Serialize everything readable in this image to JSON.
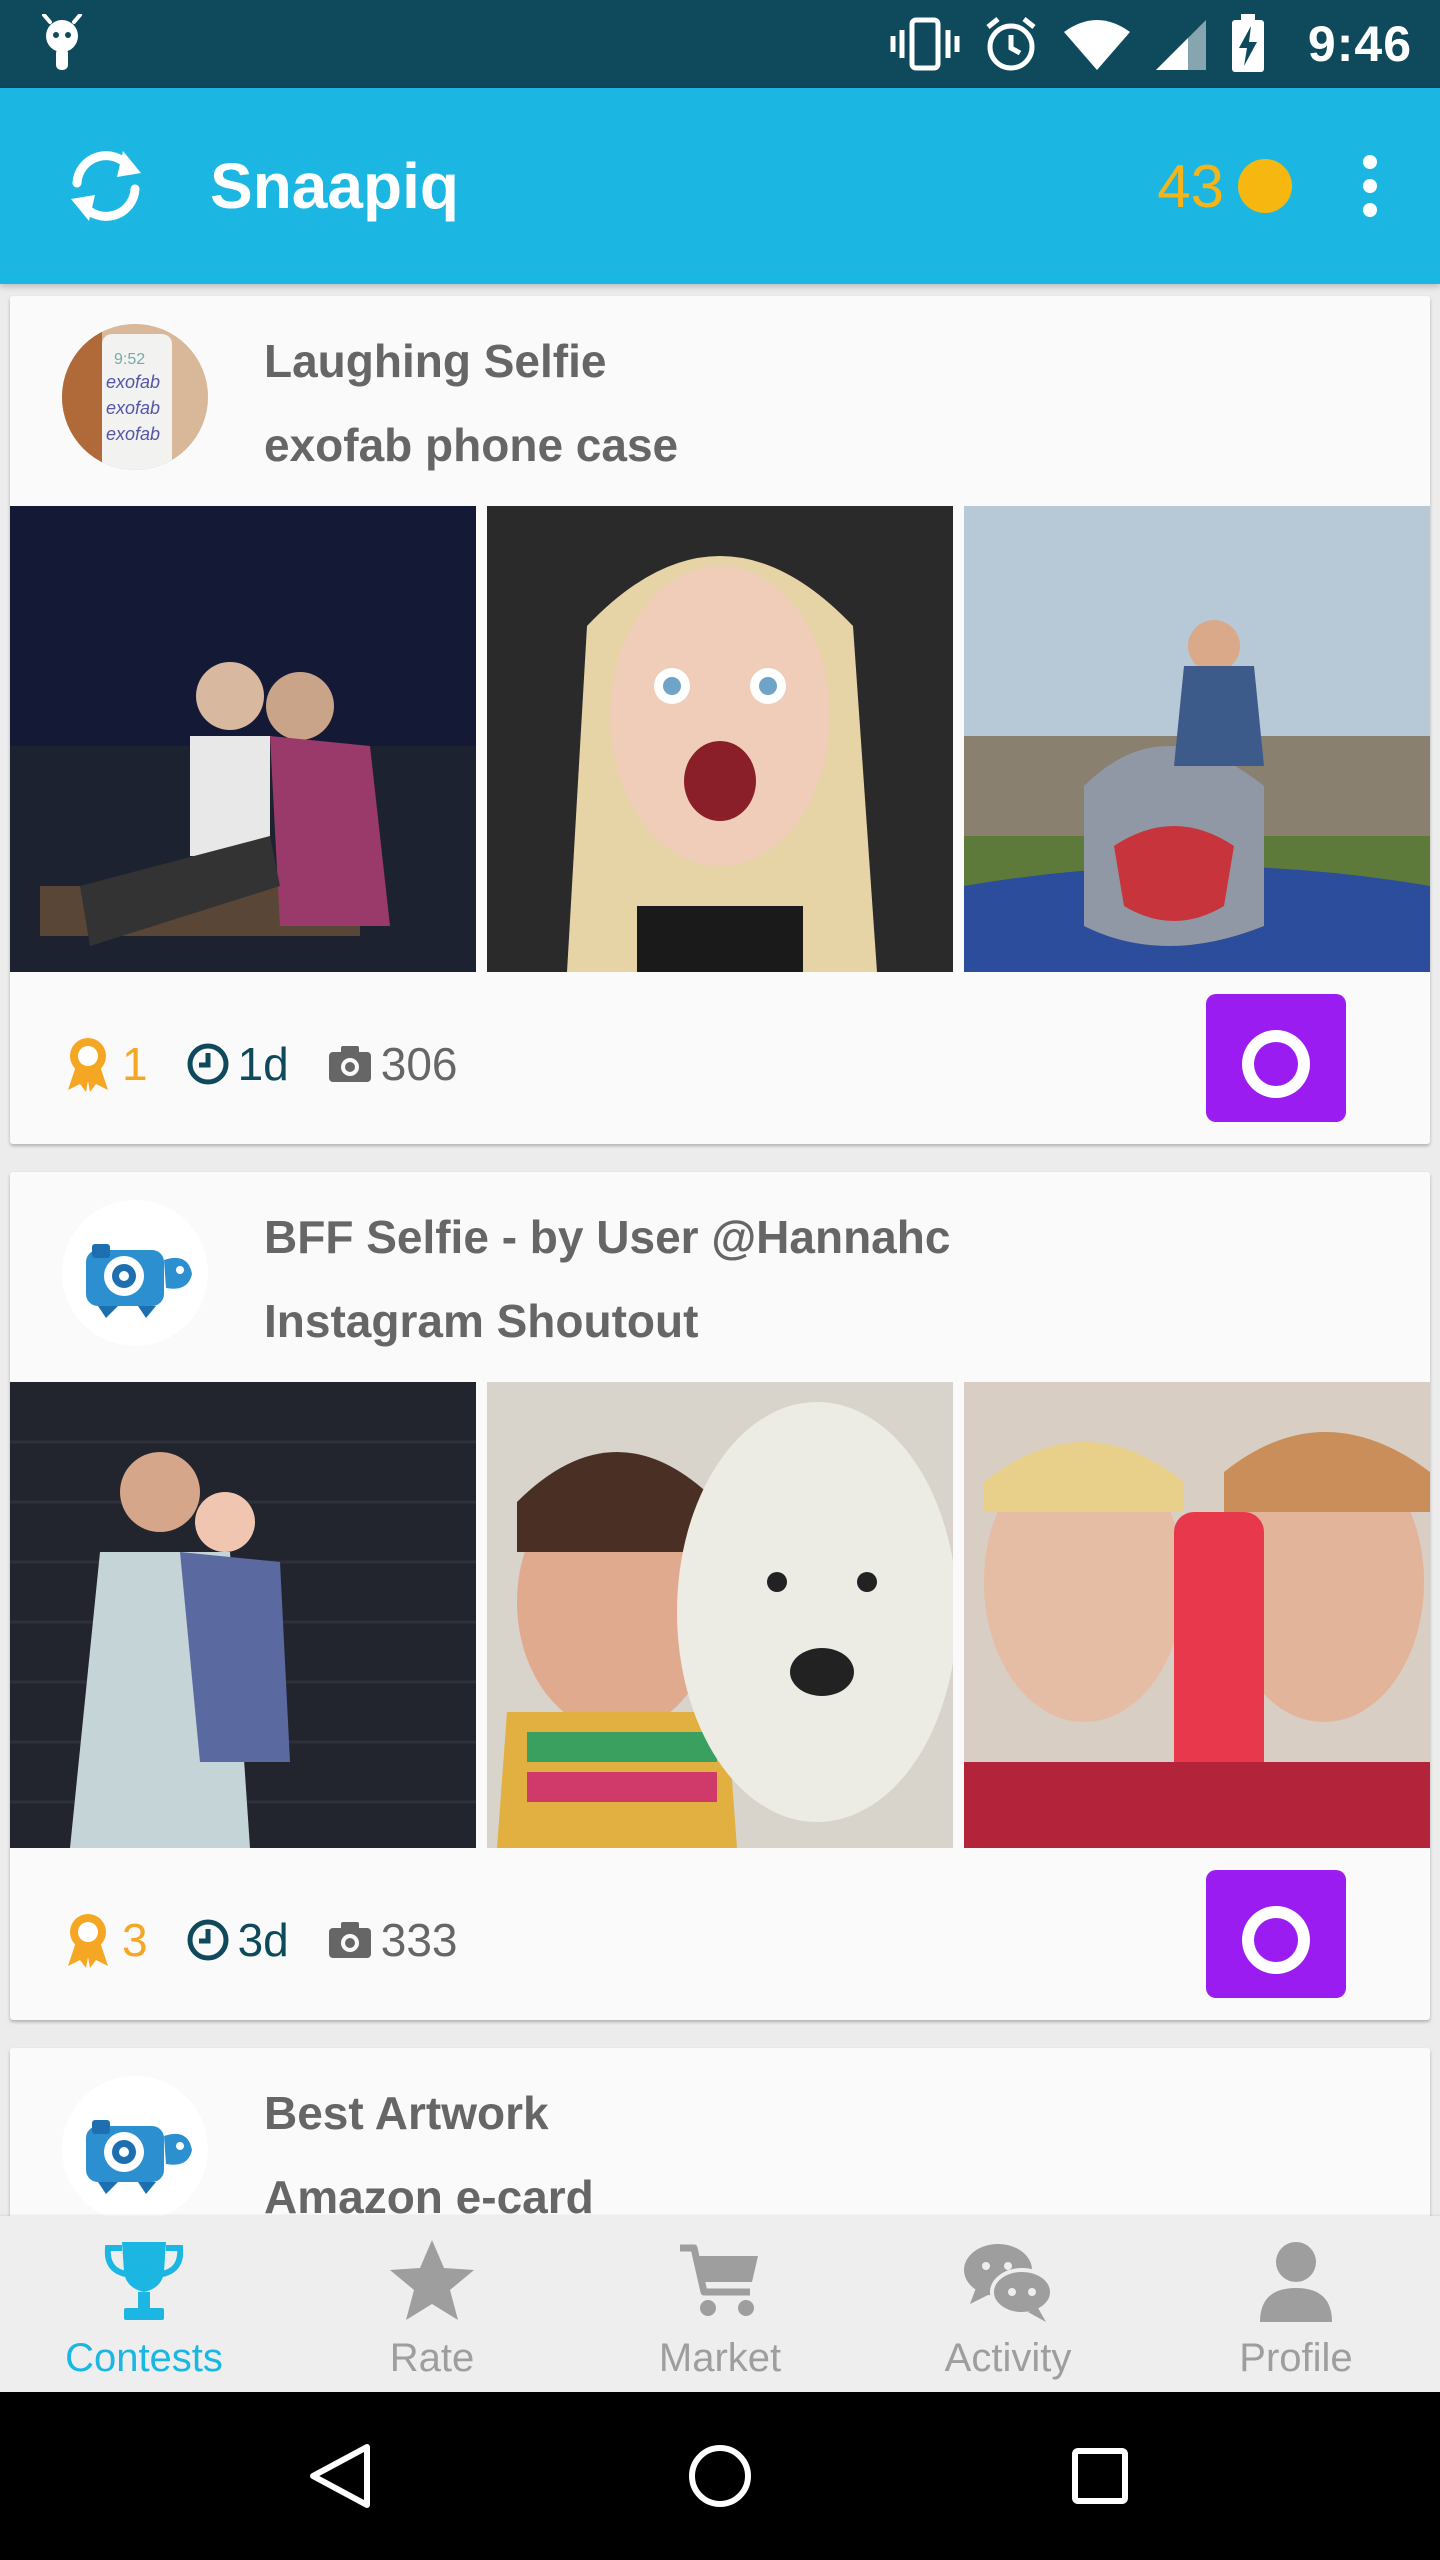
{
  "status_bar": {
    "time": "9:46"
  },
  "app_bar": {
    "title": "Snaapiq",
    "coins": "43"
  },
  "colors": {
    "accent": "#1bb7e2",
    "status_bar": "#0e4a5c",
    "camera_button": "#9b1cf0",
    "coin": "#f5b710",
    "prize": "#f5a623"
  },
  "contests": [
    {
      "title": "Laughing Selfie",
      "subtitle": "exofab phone case",
      "avatar_icon": "phone-case-avatar",
      "prizes": "1",
      "time_left": "1d",
      "photos": "306"
    },
    {
      "title": "BFF Selfie - by User @Hannahc",
      "subtitle": "Instagram Shoutout",
      "avatar_icon": "mascot-avatar",
      "prizes": "3",
      "time_left": "3d",
      "photos": "333"
    },
    {
      "title": "Best Artwork",
      "subtitle": "Amazon e-card",
      "avatar_icon": "mascot-avatar"
    }
  ],
  "bottom_nav": [
    {
      "label": "Contests",
      "icon": "trophy-icon",
      "active": true
    },
    {
      "label": "Rate",
      "icon": "star-icon",
      "active": false
    },
    {
      "label": "Market",
      "icon": "cart-icon",
      "active": false
    },
    {
      "label": "Activity",
      "icon": "chat-icon",
      "active": false
    },
    {
      "label": "Profile",
      "icon": "person-icon",
      "active": false
    }
  ]
}
